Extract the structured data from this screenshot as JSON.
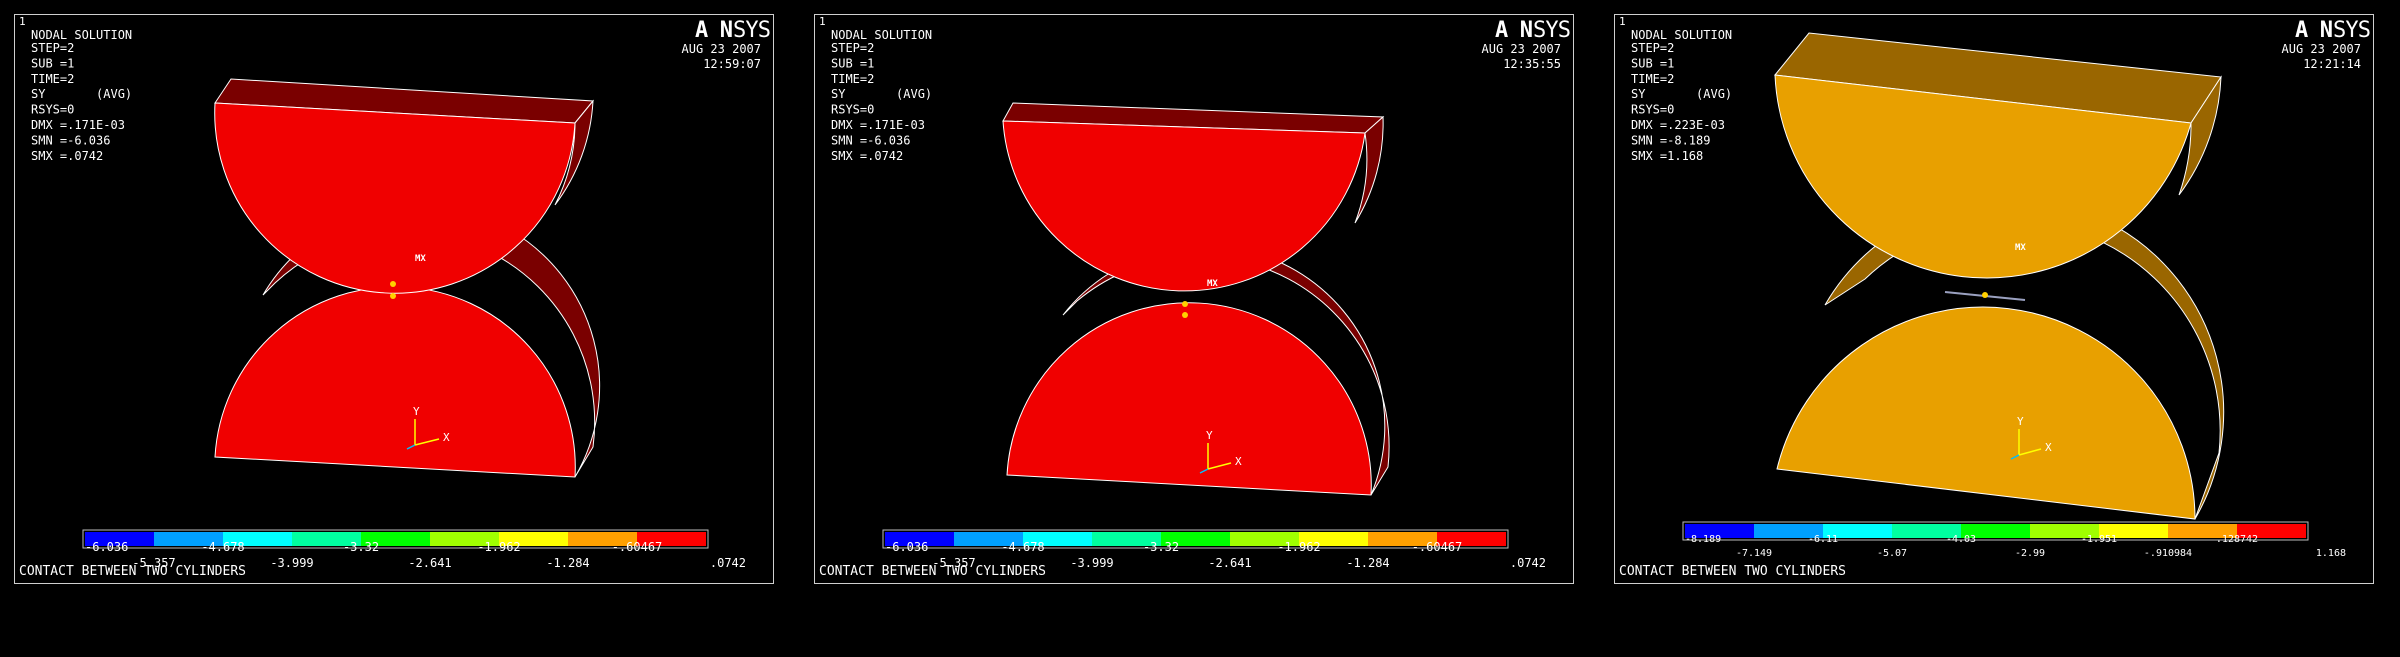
{
  "panels": [
    {
      "window_number": "1",
      "logo_an": "AN",
      "logo_sys": "SYS",
      "info": [
        "NODAL SOLUTION",
        "STEP=2",
        "SUB =1",
        "TIME=2",
        "SY       (AVG)",
        "RSYS=0",
        "DMX =.171E-03",
        "SMN =-6.036",
        "SMX =.0742"
      ],
      "date": "AUG 23 2007",
      "time": "12:59:07",
      "mx_label": "MX",
      "axis_y": "Y",
      "axis_x": "X",
      "legend_top": [
        "-6.036",
        "-4.678",
        "-3.32",
        "-1.962",
        "-.60467"
      ],
      "legend_bottom": [
        "-5.357",
        "-3.999",
        "-2.641",
        "-1.284",
        ".0742"
      ],
      "footer": "CONTACT BETWEEN TWO CYLINDERS",
      "front_color": "#f00000",
      "side_color": "#7a0000"
    },
    {
      "window_number": "1",
      "logo_an": "AN",
      "logo_sys": "SYS",
      "info": [
        "NODAL SOLUTION",
        "STEP=2",
        "SUB =1",
        "TIME=2",
        "SY       (AVG)",
        "RSYS=0",
        "DMX =.171E-03",
        "SMN =-6.036",
        "SMX =.0742"
      ],
      "date": "AUG 23 2007",
      "time": "12:35:55",
      "mx_label": "MX",
      "axis_y": "Y",
      "axis_x": "X",
      "legend_top": [
        "-6.036",
        "-4.678",
        "-3.32",
        "-1.962",
        "-.60467"
      ],
      "legend_bottom": [
        "-5.357",
        "-3.999",
        "-2.641",
        "-1.284",
        ".0742"
      ],
      "footer": "CONTACT BETWEEN TWO CYLINDERS",
      "front_color": "#f00000",
      "side_color": "#7a0000"
    },
    {
      "window_number": "1",
      "logo_an": "AN",
      "logo_sys": "SYS",
      "info": [
        "NODAL SOLUTION",
        "STEP=2",
        "SUB =1",
        "TIME=2",
        "SY       (AVG)",
        "RSYS=0",
        "DMX =.223E-03",
        "SMN =-8.189",
        "SMX =1.168"
      ],
      "date": "AUG 23 2007",
      "time": "12:21:14",
      "mx_label": "MX",
      "axis_y": "Y",
      "axis_x": "X",
      "legend_top": [
        "-8.189",
        "-6.11",
        "-4.03",
        "-1.951",
        ".128742"
      ],
      "legend_bottom": [
        "-7.149",
        "-5.07",
        "-2.99",
        "-.910984",
        "1.168"
      ],
      "footer": "CONTACT BETWEEN TWO CYLINDERS",
      "front_color": "#e8a000",
      "side_color": "#9a6600"
    }
  ],
  "legend_colors": [
    "#0000ff",
    "#00a0ff",
    "#00ffff",
    "#00ffa0",
    "#00ff00",
    "#a0ff00",
    "#ffff00",
    "#ffa000",
    "#ff0000"
  ],
  "colors": {
    "logo_sys": "#ffff00",
    "window_number": "#00c0c0",
    "axis": "#ffff00",
    "node_marker": "#ffd000"
  }
}
